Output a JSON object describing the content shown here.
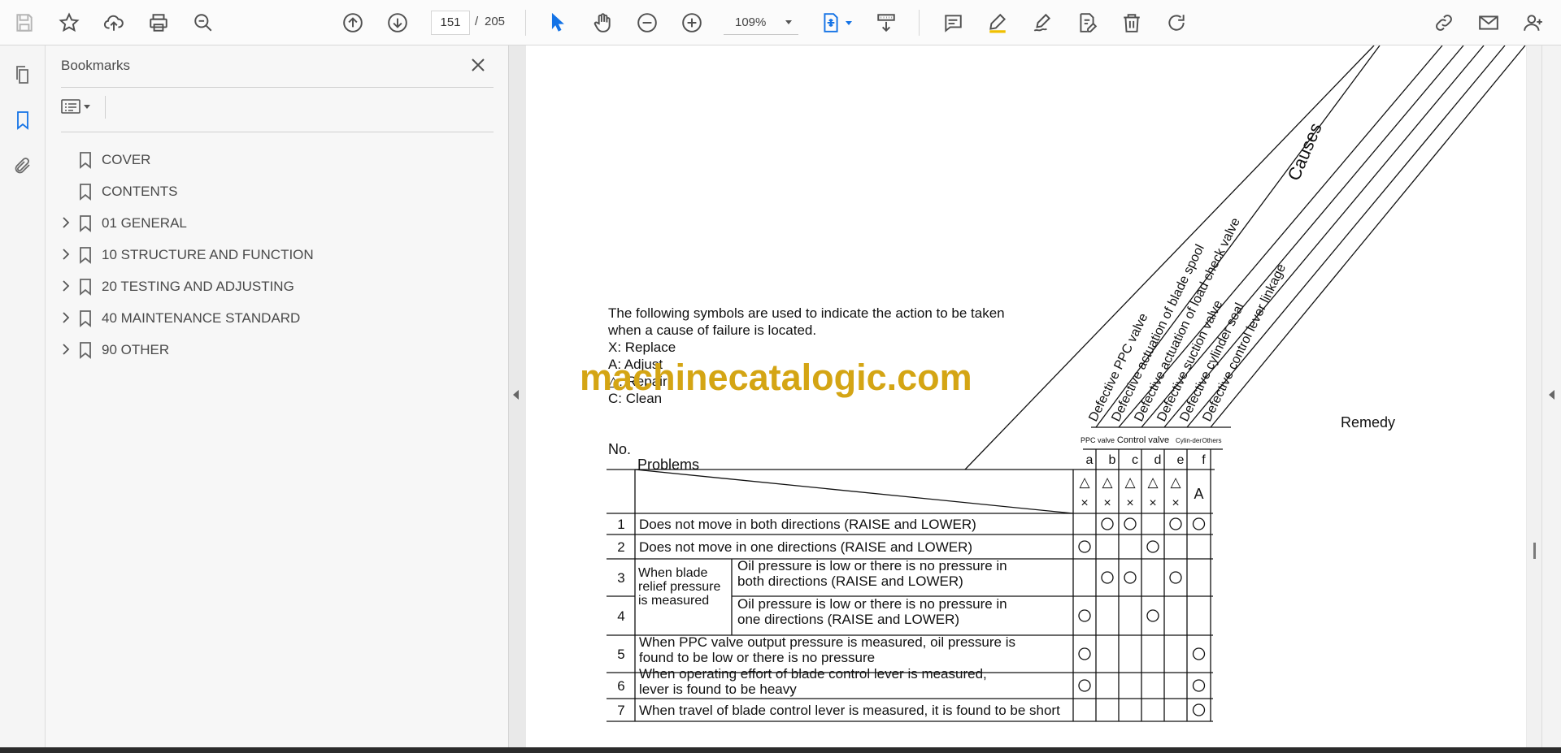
{
  "toolbar": {
    "page_current": "151",
    "page_separator": "/",
    "page_total": "205",
    "zoom": "109%"
  },
  "bookmarks_panel": {
    "title": "Bookmarks",
    "items": [
      {
        "label": "COVER",
        "expandable": false
      },
      {
        "label": "CONTENTS",
        "expandable": false
      },
      {
        "label": "01 GENERAL",
        "expandable": true
      },
      {
        "label": "10 STRUCTURE AND FUNCTION",
        "expandable": true
      },
      {
        "label": "20 TESTING AND ADJUSTING",
        "expandable": true
      },
      {
        "label": "40 MAINTENANCE STANDARD",
        "expandable": true
      },
      {
        "label": "90 OTHER",
        "expandable": true
      }
    ]
  },
  "document": {
    "watermark": "machinecatalogic.com",
    "symbols_intro_1": "The following symbols are used to indicate the action to be taken",
    "symbols_intro_2": "when a cause of failure is located.",
    "symbols": [
      "X:  Replace",
      "A:  Adjust",
      "△:  Repair",
      "C:  Clean"
    ],
    "causes_title": "Causes",
    "causes": [
      "Defective PPC valve",
      "Defective actuation of blade spool",
      "Defective actuation of load check valve",
      "Defective suction valve",
      "Defective cylinder seal",
      "Defective control lever linkage"
    ],
    "cause_groups": [
      "PPC valve",
      "Control valve",
      "Cylin-der",
      "Others"
    ],
    "cause_letters": [
      "a",
      "b",
      "c",
      "d",
      "e",
      "f"
    ],
    "remedy_label": "Remedy",
    "problems_label": "Problems",
    "no_label": "No.",
    "remedy_symbols_top": [
      "△",
      "△",
      "△",
      "△",
      "△",
      ""
    ],
    "remedy_symbols_bottom": [
      "×",
      "×",
      "×",
      "×",
      "×",
      "A"
    ],
    "group_label": "When blade relief pressure is measured",
    "rows": [
      {
        "no": "1",
        "text": "Does not move in both directions (RAISE and LOWER)",
        "marks": [
          false,
          true,
          true,
          false,
          true,
          true
        ]
      },
      {
        "no": "2",
        "text": "Does not move in one directions (RAISE and LOWER)",
        "marks": [
          true,
          false,
          false,
          true,
          false,
          false
        ]
      },
      {
        "no": "3",
        "text": "Oil pressure is low or there is no pressure in both directions (RAISE and LOWER)",
        "marks": [
          false,
          true,
          true,
          false,
          true,
          false
        ]
      },
      {
        "no": "4",
        "text": "Oil pressure is low or there is no pressure in one directions (RAISE and LOWER)",
        "marks": [
          true,
          false,
          false,
          true,
          false,
          false
        ]
      },
      {
        "no": "5",
        "text": "When PPC valve output pressure is measured, oil pressure is found to be low or there is no pressure",
        "marks": [
          true,
          false,
          false,
          false,
          false,
          true
        ]
      },
      {
        "no": "6",
        "text": "When operating effort of blade control lever is measured, lever is found to be heavy",
        "marks": [
          true,
          false,
          false,
          false,
          false,
          true
        ]
      },
      {
        "no": "7",
        "text": "When travel of blade control lever is measured, it is found to be short",
        "marks": [
          false,
          false,
          false,
          false,
          false,
          true
        ]
      }
    ]
  }
}
